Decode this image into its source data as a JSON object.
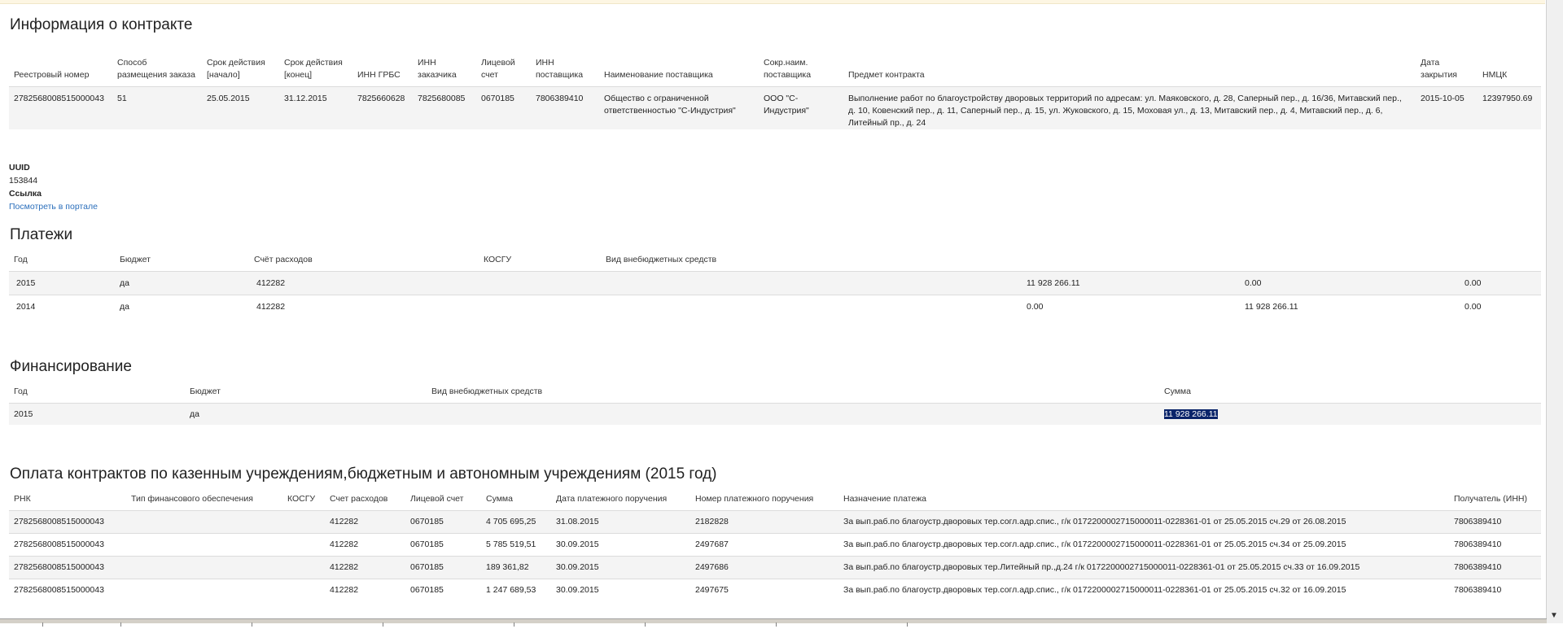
{
  "contract": {
    "title": "Информация о контракте",
    "headers": [
      "Реестровый номер",
      "Способ размещения заказа",
      "Срок действия [начало]",
      "Срок действия [конец]",
      "ИНН ГРБС",
      "ИНН заказчика",
      "Лицевой счет",
      "ИНН поставщика",
      "Наименование поставщика",
      "Сокр.наим. поставщика",
      "Предмет контракта",
      "Дата закрытия",
      "НМЦК"
    ],
    "row": [
      "2782568008515000043",
      "51",
      "25.05.2015",
      "31.12.2015",
      "7825660628",
      "7825680085",
      "0670185",
      "7806389410",
      "Общество с ограниченной ответственностью \"С-Индустрия\"",
      "ООО \"С-Индустрия\"",
      "Выполнение работ по благоустройству дворовых территорий по адресам: ул. Маяковского, д. 28, Саперный пер., д. 16/36, Митавский пер., д. 10, Ковенский пер., д. 11, Саперный пер., д. 15, ул. Жуковского, д. 15, Моховая ул., д. 13, Митавский пер., д. 4, Митавский пер., д. 6, Литейный пр., д. 24",
      "2015-10-05",
      "12397950.69"
    ]
  },
  "info": {
    "uuid_label": "UUID",
    "uuid_value": "153844",
    "link_label": "Ссылка",
    "link_text": "Посмотреть в портале"
  },
  "payments": {
    "title": "Платежи",
    "headers": [
      "Год",
      "Бюджет",
      "Счёт расходов",
      "КОСГУ",
      "Вид внебюджетных средств",
      "",
      "",
      ""
    ],
    "rows": [
      [
        "2015",
        "да",
        "412282",
        "",
        "",
        "11 928 266.11",
        "0.00",
        "0.00"
      ],
      [
        "2014",
        "да",
        "412282",
        "",
        "",
        "0.00",
        "11 928 266.11",
        "0.00"
      ]
    ]
  },
  "financing": {
    "title": "Финансирование",
    "headers": [
      "Год",
      "Бюджет",
      "Вид внебюджетных средств",
      "Сумма"
    ],
    "row": [
      "2015",
      "да",
      "",
      "11 928 266.11"
    ]
  },
  "contract_payments": {
    "title": "Оплата контрактов по казенным учреждениям,бюджетным и автономным учреждениям (2015 год)",
    "headers": [
      "РНК",
      "Тип финансового обеспечения",
      "КОСГУ",
      "Счет расходов",
      "Лицевой счет",
      "Сумма",
      "Дата платежного поручения",
      "Номер платежного поручения",
      "Назначение платежа",
      "Получатель (ИНН)"
    ],
    "rows": [
      [
        "2782568008515000043",
        "",
        "",
        "412282",
        "0670185",
        "4 705 695,25",
        "31.08.2015",
        "2182828",
        "За вып.раб.по благоустр.дворовых тер.согл.адр.спис., г/к 0172200002715000011-0228361-01 от 25.05.2015 сч.29 от 26.08.2015",
        "7806389410"
      ],
      [
        "2782568008515000043",
        "",
        "",
        "412282",
        "0670185",
        "5 785 519,51",
        "30.09.2015",
        "2497687",
        "За вып.раб.по благоустр.дворовых тер.согл.адр.спис., г/к 0172200002715000011-0228361-01 от 25.05.2015 сч.34 от 25.09.2015",
        "7806389410"
      ],
      [
        "2782568008515000043",
        "",
        "",
        "412282",
        "0670185",
        "189 361,82",
        "30.09.2015",
        "2497686",
        "За вып.раб.по благоустр.дворовых тер.Литейный пр.,д.24 г/к 0172200002715000011-0228361-01 от 25.05.2015 сч.33 от 16.09.2015",
        "7806389410"
      ],
      [
        "2782568008515000043",
        "",
        "",
        "412282",
        "0670185",
        "1 247 689,53",
        "30.09.2015",
        "2497675",
        "За вып.раб.по благоустр.дворовых тер.согл.адр.спис., г/к 0172200002715000011-0228361-01 от 25.05.2015 сч.32 от 16.09.2015",
        "7806389410"
      ]
    ]
  },
  "icons": {
    "scroll_down": "scroll-down-arrow-icon"
  }
}
